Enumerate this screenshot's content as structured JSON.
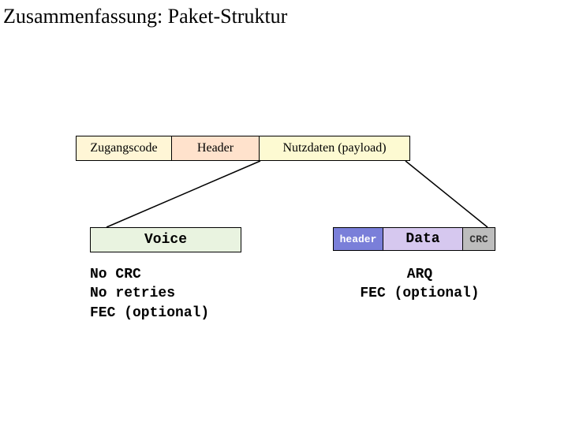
{
  "title": "Zusammenfassung: Paket-Struktur",
  "packet": {
    "access": "Zugangscode",
    "header": "Header",
    "payload": "Nutzdaten (payload)"
  },
  "voice": {
    "label": "Voice",
    "note1": "No CRC",
    "note2": "No retries",
    "note3": "FEC (optional)"
  },
  "data": {
    "hdr": "header",
    "body": "Data",
    "crc": "CRC",
    "note1": "ARQ",
    "note2": "FEC (optional)"
  }
}
